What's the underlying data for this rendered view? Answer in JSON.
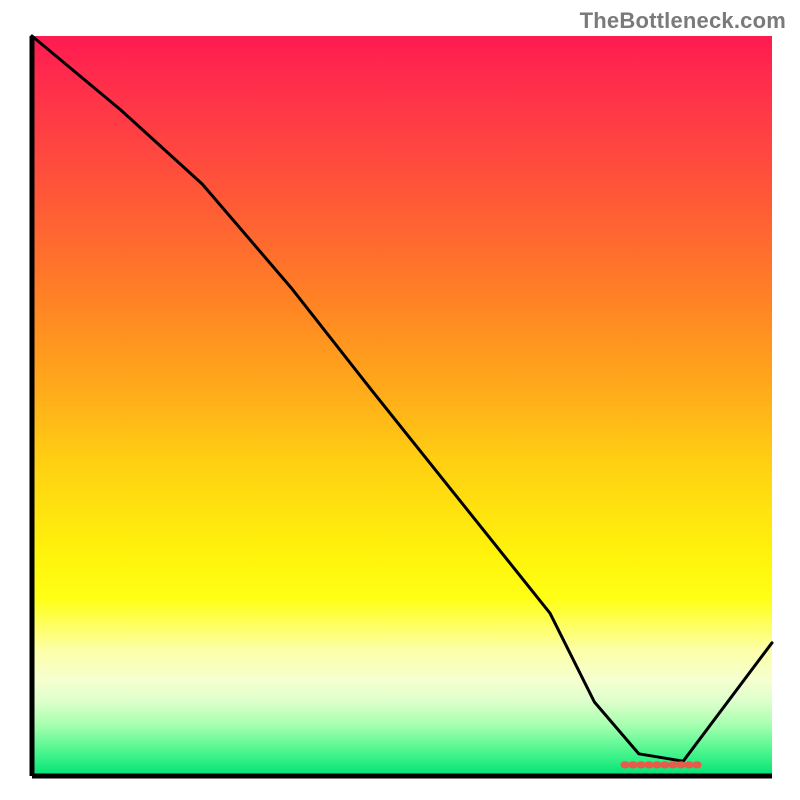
{
  "watermark": "TheBottleneck.com",
  "colors": {
    "gradient_top": "#ff1b50",
    "gradient_bottom": "#00e176",
    "curve": "#000000",
    "marker": "#e95a4a",
    "axis": "#000000",
    "watermark_text": "#7a7a7a"
  },
  "chart_data": {
    "type": "line",
    "title": "",
    "xlabel": "",
    "ylabel": "",
    "xlim": [
      0,
      100
    ],
    "ylim": [
      0,
      100
    ],
    "series": [
      {
        "name": "curve",
        "x": [
          0,
          12,
          23,
          35,
          46,
          58,
          70,
          76,
          82,
          88,
          100
        ],
        "y": [
          100,
          90,
          80,
          66,
          52,
          37,
          22,
          10,
          3,
          2,
          18
        ]
      }
    ],
    "marker": {
      "name": "recommended-range",
      "x_start": 80,
      "x_end": 90,
      "y": 1.5
    }
  }
}
